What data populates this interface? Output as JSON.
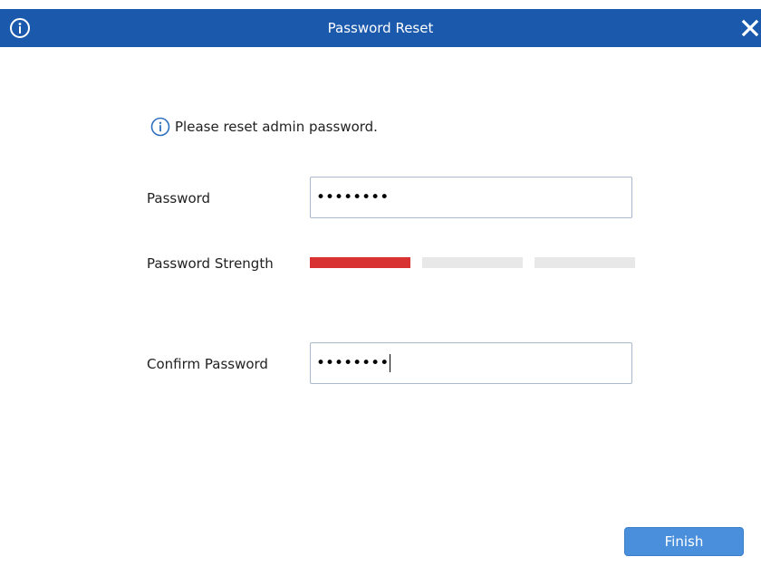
{
  "window": {
    "title": "Password Reset",
    "info_icon": "info-icon",
    "close_icon": "close-icon"
  },
  "notice": {
    "icon": "info-icon",
    "text": "Please reset admin password."
  },
  "form": {
    "password_label": "Password",
    "password_value": "••••••••",
    "strength_label": "Password Strength",
    "strength_level": 1,
    "strength_levels_total": 3,
    "confirm_label": "Confirm Password",
    "confirm_value": "••••••••"
  },
  "actions": {
    "finish_label": "Finish"
  },
  "colors": {
    "titlebar": "#1b59ad",
    "strength_weak": "#d83232",
    "strength_empty": "#e8e8e8",
    "button": "#4a8fdb"
  }
}
